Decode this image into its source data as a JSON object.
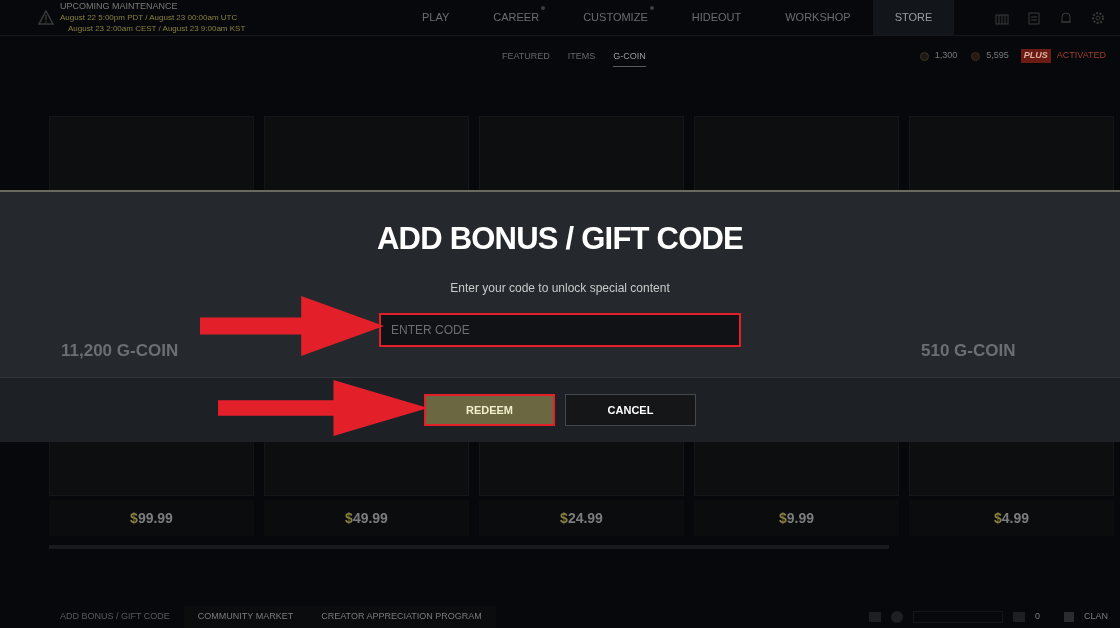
{
  "maintenance": {
    "title": "UPCOMING MAINTENANCE",
    "lines": [
      "August 22 5:00pm PDT / August 23 00:00am UTC",
      "August 23 2:00am CEST / August 23 9:00am KST"
    ]
  },
  "nav": [
    {
      "label": "PLAY",
      "selected": false,
      "dot": false
    },
    {
      "label": "CAREER",
      "selected": false,
      "dot": true
    },
    {
      "label": "CUSTOMIZE",
      "selected": false,
      "dot": true
    },
    {
      "label": "HIDEOUT",
      "selected": false,
      "dot": false
    },
    {
      "label": "WORKSHOP",
      "selected": false,
      "dot": false
    },
    {
      "label": "STORE",
      "selected": true,
      "dot": false
    }
  ],
  "subnav": [
    {
      "label": "FEATURED",
      "selected": false
    },
    {
      "label": "ITEMS",
      "selected": false
    },
    {
      "label": "G-COIN",
      "selected": true
    }
  ],
  "currency": {
    "g_coin": "1,300",
    "bp": "5,595",
    "plus_badge": "PLUS",
    "plus_status": "ACTIVATED"
  },
  "cards": [
    {
      "title": "11,200 G-COIN",
      "price": "99.99",
      "currency_sign": "$"
    },
    {
      "price": "49.99",
      "currency_sign": "$"
    },
    {
      "price": "24.99",
      "currency_sign": "$"
    },
    {
      "price": "9.99",
      "currency_sign": "$"
    },
    {
      "title": "510 G-COIN",
      "price": "4.99",
      "currency_sign": "$"
    }
  ],
  "modal": {
    "title": "ADD BONUS / GIFT CODE",
    "subtitle": "Enter your code to unlock special content",
    "code_field": {
      "placeholder": "ENTER CODE"
    },
    "buttons": [
      {
        "label": "REDEEM",
        "kind": "primary"
      },
      {
        "label": "CANCEL",
        "kind": "secondary"
      }
    ]
  },
  "footer": {
    "links": [
      "ADD BONUS / GIFT CODE",
      "COMMUNITY MARKET",
      "CREATOR APPRECIATION PROGRAM"
    ],
    "friends_count": "0",
    "clan": "CLAN"
  }
}
